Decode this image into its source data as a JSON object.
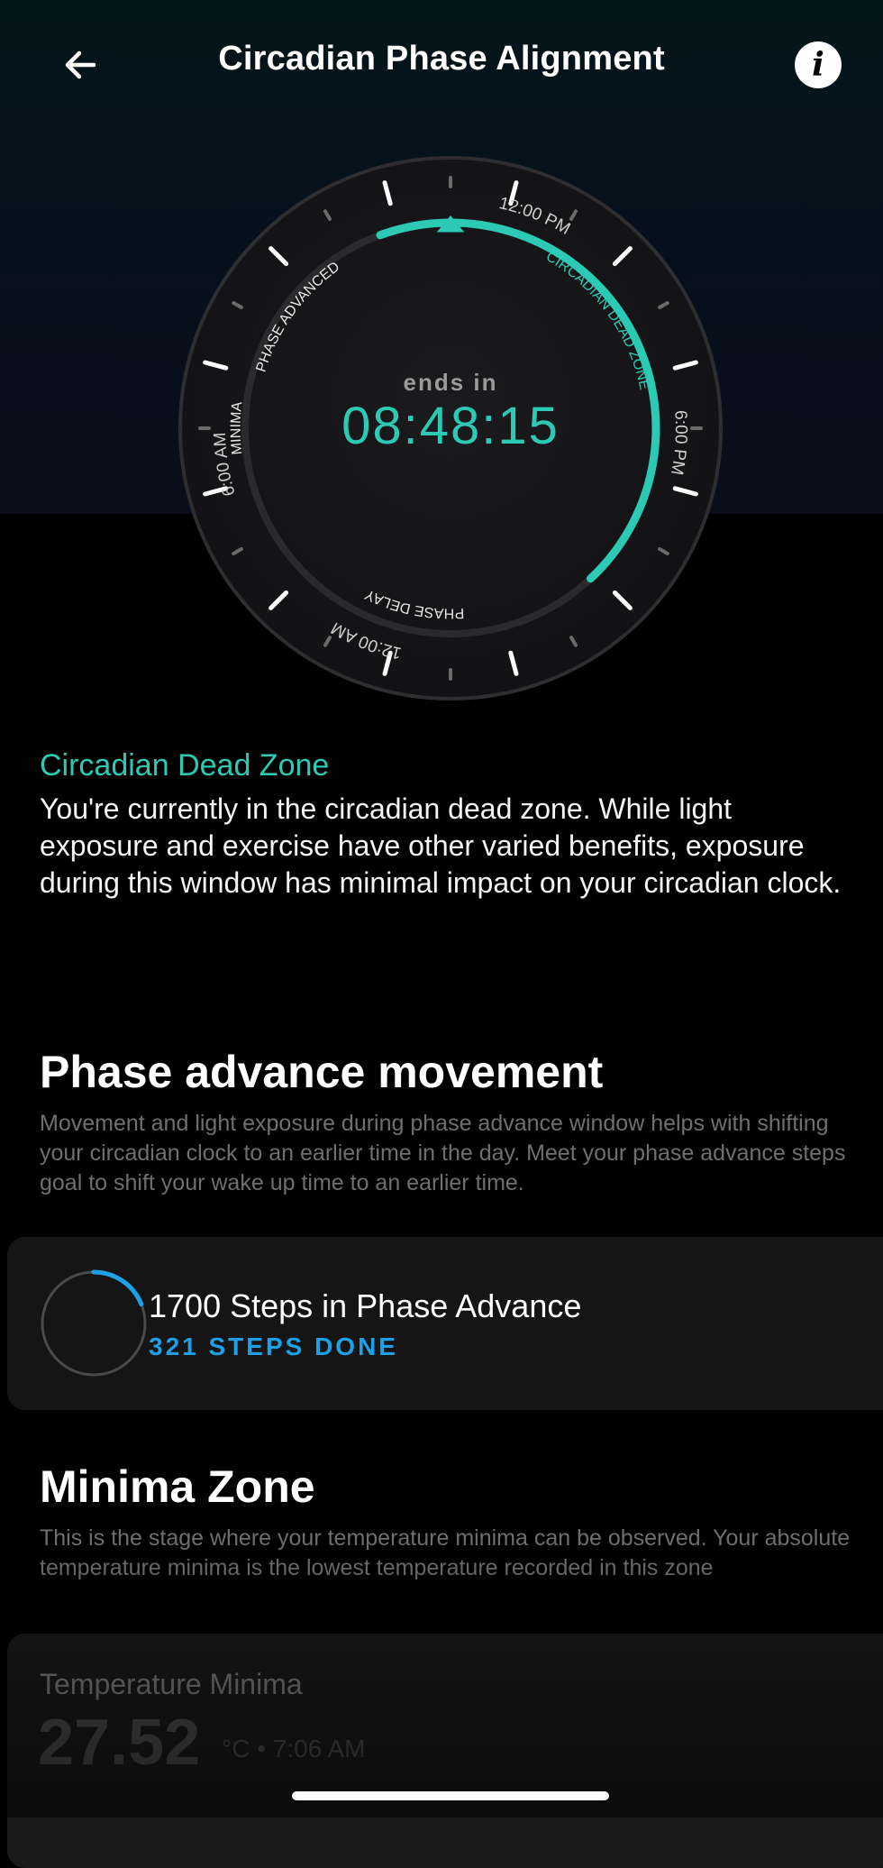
{
  "header": {
    "title": "Circadian Phase Alignment",
    "back_icon": "arrow-left-icon",
    "info_icon": "info-icon",
    "info_glyph": "i"
  },
  "dial": {
    "countdown_label": "ends in",
    "countdown_value": "08:48:15",
    "time_labels": {
      "top": "12:00 PM",
      "right": "6:00 PM",
      "bottom": "12:00 AM",
      "left": "6:00 AM"
    },
    "zone_labels": {
      "dead_zone": "CIRCADIAN DEAD ZONE",
      "phase_advanced": "PHASE ADVANCED",
      "minima": "MINIMA",
      "phase_delay": "PHASE DELAY"
    },
    "accent_color": "#2cc9b4"
  },
  "current_zone": {
    "title": "Circadian Dead Zone",
    "description": "You're currently in the circadian dead zone. While light exposure and exercise have other varied benefits, exposure during this window has minimal impact on your circadian clock."
  },
  "phase_advance": {
    "heading": "Phase advance movement",
    "description": "Movement and light exposure during phase advance window helps with shifting your circadian clock to an earlier time in the day. Meet your phase advance steps goal to shift your wake up time to an earlier time.",
    "steps_goal_label": "1700 Steps in Phase Advance",
    "steps_done_label": "321 STEPS DONE",
    "steps_goal": 1700,
    "steps_done": 321,
    "progress_color": "#1ea0e6"
  },
  "minima_zone": {
    "heading": "Minima Zone",
    "description": "This is the stage where your temperature minima can be observed. Your absolute temperature minima is the lowest temperature recorded in this zone",
    "card_label": "Temperature Minima",
    "value": "27.52",
    "meta": "°C • 7:06 AM"
  }
}
